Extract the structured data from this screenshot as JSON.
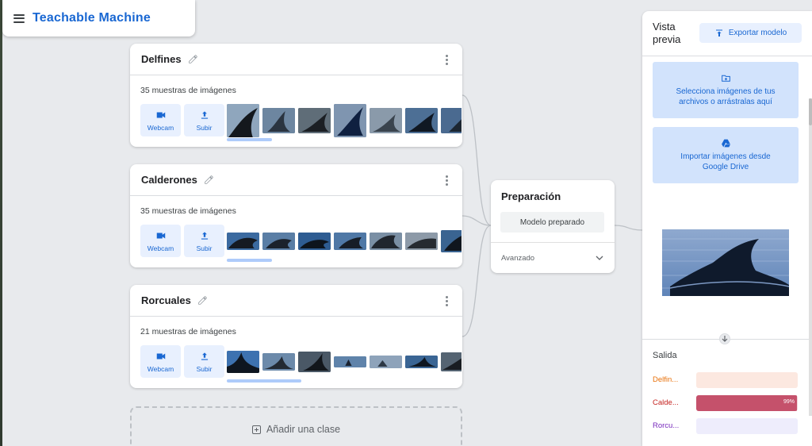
{
  "app": {
    "title": "Teachable Machine"
  },
  "classes": [
    {
      "name": "Delfines",
      "count_text": "35 muestras de imágenes",
      "webcam_label": "Webcam",
      "upload_label": "Subir"
    },
    {
      "name": "Calderones",
      "count_text": "35 muestras de imágenes",
      "webcam_label": "Webcam",
      "upload_label": "Subir"
    },
    {
      "name": "Rorcuales",
      "count_text": "21 muestras de imágenes",
      "webcam_label": "Webcam",
      "upload_label": "Subir"
    }
  ],
  "add_class": {
    "label": "Añadir una clase"
  },
  "training": {
    "title": "Preparación",
    "button_label": "Modelo preparado",
    "advanced_label": "Avanzado"
  },
  "preview": {
    "title_line1": "Vista",
    "title_line2": "previa",
    "export_label": "Exportar modelo",
    "drop_line1": "Selecciona imágenes de tus",
    "drop_line2": "archivos o arrástralas aquí",
    "drive_line1": "Importar imágenes desde",
    "drive_line2": "Google Drive",
    "output_title": "Salida",
    "outputs": [
      {
        "label": "Delfin...",
        "percent_text": "",
        "confidence": 0.0,
        "color": "#e8710a",
        "track": "#fce8e0",
        "fill": "#e8710a"
      },
      {
        "label": "Calde...",
        "percent_text": "99%",
        "confidence": 0.99,
        "color": "#c5221f",
        "track": "#f3d6db",
        "fill": "#c5516b"
      },
      {
        "label": "Rorcu...",
        "percent_text": "",
        "confidence": 0.0,
        "color": "#7627bb",
        "track": "#eeedfc",
        "fill": "#7627bb"
      }
    ]
  },
  "colors": {
    "accent": "#1967d2",
    "button_bg": "#e8f0fe",
    "drop_bg": "#d2e3fc",
    "page_bg": "#e8eaed"
  },
  "icons": [
    "menu-icon",
    "pencil-icon",
    "more-vert-icon",
    "webcam-icon",
    "upload-icon",
    "chevron-down-icon",
    "export-icon",
    "folder-add-icon",
    "google-drive-icon",
    "arrow-down-icon",
    "add-box-icon"
  ]
}
